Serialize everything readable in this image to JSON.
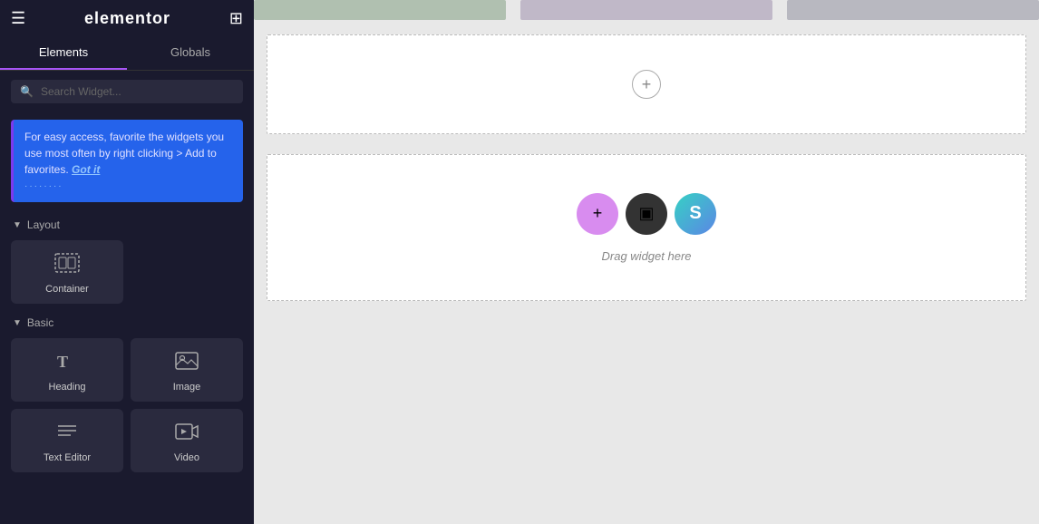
{
  "topbar": {
    "logo": "elementor",
    "hamburger_icon": "☰",
    "grid_icon": "⊞"
  },
  "tabs": [
    {
      "id": "elements",
      "label": "Elements",
      "active": true
    },
    {
      "id": "globals",
      "label": "Globals",
      "active": false
    }
  ],
  "search": {
    "placeholder": "Search Widget...",
    "value": ""
  },
  "tip_banner": {
    "text": "For easy access, favorite the widgets you use most often by right clicking > Add to favorites.",
    "link_text": "Got it",
    "dots": "········"
  },
  "sections": [
    {
      "id": "layout",
      "label": "Layout",
      "widgets": [
        {
          "id": "container",
          "label": "Container",
          "icon": "container"
        }
      ]
    },
    {
      "id": "basic",
      "label": "Basic",
      "widgets": [
        {
          "id": "heading",
          "label": "Heading",
          "icon": "heading"
        },
        {
          "id": "image",
          "label": "Image",
          "icon": "image"
        },
        {
          "id": "text-editor",
          "label": "Text Editor",
          "icon": "text"
        },
        {
          "id": "video",
          "label": "Video",
          "icon": "video"
        }
      ]
    }
  ],
  "canvas": {
    "empty_section_plus": "+",
    "drag_text": "Drag widget here",
    "widget_circles": [
      {
        "id": "plus-circle",
        "icon": "+",
        "class": "wc-pink"
      },
      {
        "id": "folder-circle",
        "icon": "▣",
        "class": "wc-dark"
      },
      {
        "id": "s-circle",
        "icon": "S",
        "class": "wc-teal"
      }
    ]
  }
}
